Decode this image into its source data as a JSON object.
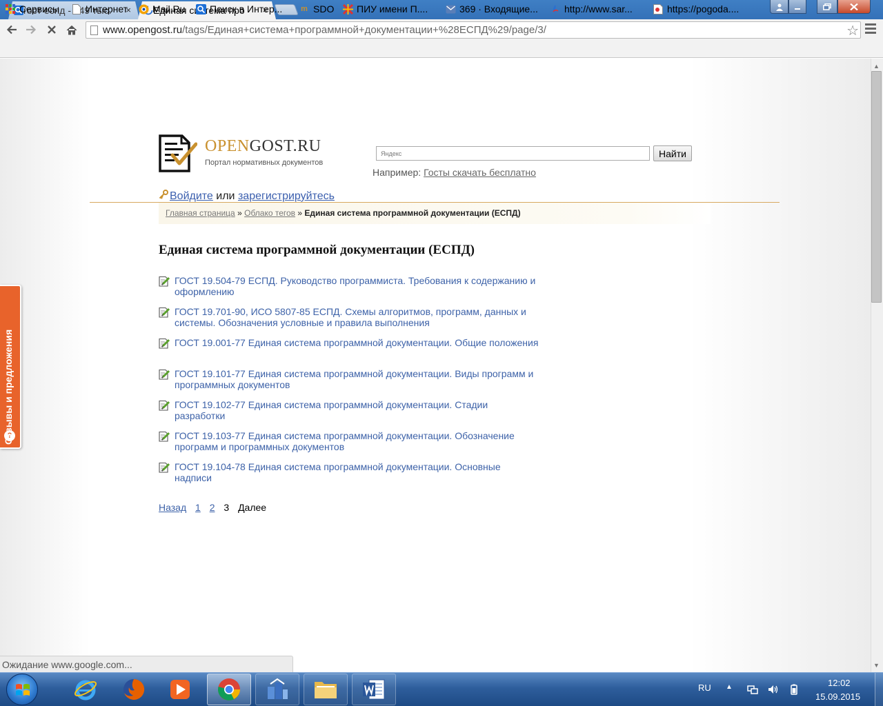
{
  "browser": {
    "tabs": [
      {
        "title": "гост еспд - 549 тыс.",
        "close": "×"
      },
      {
        "title": "Единая система про",
        "close": "×"
      }
    ],
    "url_host": "www.opengost.ru",
    "url_path": "/tags/Единая+система+программной+документации+%28ЕСПД%29/page/3/",
    "star": "☆",
    "bookmarks": [
      {
        "label": "Сервисы",
        "icon": "apps-icon"
      },
      {
        "label": "Интернет",
        "icon": "page-icon"
      },
      {
        "label": "Mail.Ru",
        "icon": "mailru-icon"
      },
      {
        "label": "Поиск в Интер...",
        "icon": "search-icon"
      },
      {
        "label": "SDO",
        "icon": "sdo-icon"
      },
      {
        "label": "ПИУ имени П....",
        "icon": "piu-icon"
      },
      {
        "label": "369 · Входящие...",
        "icon": "mail-icon"
      },
      {
        "label": "http://www.sar...",
        "icon": "link-icon"
      },
      {
        "label": "https://pogoda....",
        "icon": "weather-icon"
      }
    ],
    "status": "Ожидание www.google.com..."
  },
  "site": {
    "logo_open": "OPEN",
    "logo_gost": "GOST.RU",
    "logo_subtitle": "Портал нормативных документов",
    "search_placeholder": "Яндекс",
    "search_button": "Найти",
    "example_prefix": "Например:",
    "example_link": "Госты скачать бесплатно",
    "auth_login": "Войдите",
    "auth_or": "или",
    "auth_register": "зарегистрируйтесь",
    "breadcrumb": {
      "home": "Главная страница",
      "sep": "»",
      "tags": "Облако тегов",
      "current": "Единая система программной документации (ЕСПД)"
    },
    "heading": "Единая система программной документации (ЕСПД)",
    "documents": [
      "ГОСТ 19.504-79 ЕСПД. Руководство программиста. Требования к содержанию и оформлению",
      "ГОСТ 19.701-90, ИСО 5807-85 ЕСПД. Схемы алгоритмов, программ, данных и системы. Обозначения условные и правила выполнения",
      "ГОСТ 19.001-77 Единая система программной документации. Общие положения",
      "ГОСТ 19.101-77 Единая система программной документации. Виды программ и программных документов",
      "ГОСТ 19.102-77 Единая система программной документации. Стадии разработки",
      "ГОСТ 19.103-77 Единая система программной документации. Обозначение программ и программных документов",
      "ГОСТ 19.104-78 Единая система программной документации. Основные надписи"
    ],
    "pager": {
      "back": "Назад",
      "page1": "1",
      "page2": "2",
      "current": "3",
      "next": "Далее"
    },
    "feedback": "Отзывы и предложения"
  },
  "taskbar": {
    "lang": "RU",
    "time": "12:02",
    "date": "15.09.2015",
    "apps": [
      "ie-icon",
      "firefox-icon",
      "media-player-icon",
      "chrome-icon",
      "network-app-icon",
      "explorer-icon",
      "word-icon"
    ]
  },
  "colors": {
    "accent_gold": "#c9912f",
    "link_blue": "#3d62a8",
    "feedback_orange": "#e8632b"
  }
}
